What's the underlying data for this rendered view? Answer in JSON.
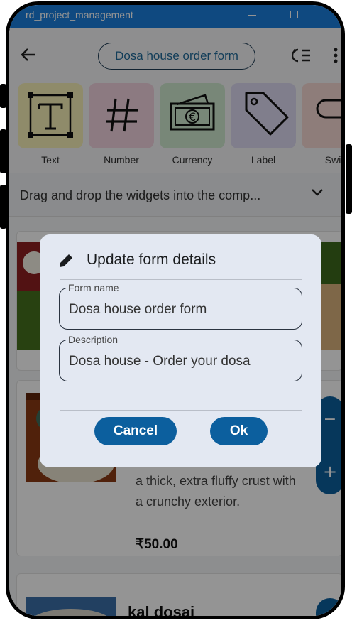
{
  "window": {
    "title": "rd_project_management"
  },
  "appbar": {
    "form_title": "Dosa house order form"
  },
  "widgets": [
    {
      "label": "Text",
      "color": "#f6efb7"
    },
    {
      "label": "Number",
      "color": "#f1d3df"
    },
    {
      "label": "Currency",
      "color": "#cfe9cf"
    },
    {
      "label": "Label",
      "color": "#dcd9f1"
    },
    {
      "label": "Swit",
      "color": "#f4d7d3"
    }
  ],
  "drag_hint": "Drag and drop the widgets into the comp...",
  "items": [
    {
      "description_lines": [
        "a thick, extra fluffy crust with",
        "a crunchy exterior."
      ],
      "price": "₹50.00",
      "stepper_minus": "−",
      "stepper_plus": "+"
    },
    {
      "name": "kal dosai"
    }
  ],
  "dialog": {
    "title": "Update form details",
    "form_name_label": "Form name",
    "form_name_value": "Dosa house order form",
    "description_label": "Description",
    "description_value": "Dosa house - Order your dosa",
    "cancel_label": "Cancel",
    "ok_label": "Ok"
  },
  "colors": {
    "accent": "#0c5f9e",
    "titlebar": "#1a7fdc"
  }
}
